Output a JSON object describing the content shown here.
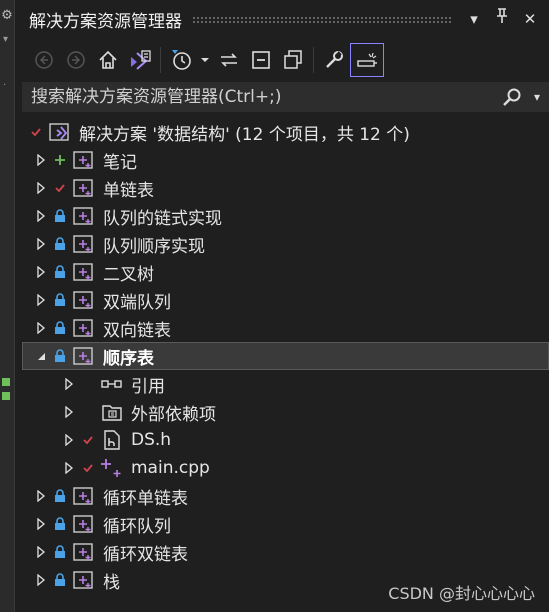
{
  "window": {
    "title": "解决方案资源管理器",
    "buttons": [
      "▾",
      "⊥",
      "✕"
    ]
  },
  "toolbar": {
    "items": [
      "back-icon",
      "forward-icon",
      "home-icon",
      "vs-solution-switch-icon",
      "history-icon",
      "dropdown-icon",
      "sync-icon",
      "collapse-all-icon",
      "show-all-files-icon",
      "properties-wrench-icon",
      "preview-selected-icon"
    ]
  },
  "search": {
    "placeholder": "搜索解决方案资源管理器(Ctrl+;)"
  },
  "solution": {
    "label": "解决方案 '数据结构' (12 个项目，共 12 个)"
  },
  "tree": [
    {
      "label": "笔记",
      "status": "add",
      "depth": 0,
      "icon": "project",
      "expander": "collapsed"
    },
    {
      "label": "单链表",
      "status": "check",
      "depth": 0,
      "icon": "project",
      "expander": "collapsed"
    },
    {
      "label": "队列的链式实现",
      "status": "lock",
      "depth": 0,
      "icon": "project",
      "expander": "collapsed"
    },
    {
      "label": "队列顺序实现",
      "status": "lock",
      "depth": 0,
      "icon": "project",
      "expander": "collapsed"
    },
    {
      "label": "二叉树",
      "status": "lock",
      "depth": 0,
      "icon": "project",
      "expander": "collapsed"
    },
    {
      "label": "双端队列",
      "status": "lock",
      "depth": 0,
      "icon": "project",
      "expander": "collapsed"
    },
    {
      "label": "双向链表",
      "status": "lock",
      "depth": 0,
      "icon": "project",
      "expander": "collapsed"
    },
    {
      "label": "顺序表",
      "status": "lock",
      "depth": 0,
      "icon": "project",
      "expander": "expanded",
      "selected": true,
      "bold": true
    },
    {
      "label": "引用",
      "status": "none",
      "depth": 1,
      "icon": "references",
      "expander": "collapsed"
    },
    {
      "label": "外部依赖项",
      "status": "none",
      "depth": 1,
      "icon": "external-deps",
      "expander": "collapsed"
    },
    {
      "label": "DS.h",
      "status": "check",
      "depth": 1,
      "icon": "header-file",
      "expander": "collapsed"
    },
    {
      "label": "main.cpp",
      "status": "check",
      "depth": 1,
      "icon": "cpp-file",
      "expander": "collapsed"
    },
    {
      "label": "循环单链表",
      "status": "lock",
      "depth": 0,
      "icon": "project",
      "expander": "collapsed"
    },
    {
      "label": "循环队列",
      "status": "lock",
      "depth": 0,
      "icon": "project",
      "expander": "collapsed"
    },
    {
      "label": "循环双链表",
      "status": "lock",
      "depth": 0,
      "icon": "project",
      "expander": "collapsed"
    },
    {
      "label": "栈",
      "status": "lock",
      "depth": 0,
      "icon": "project",
      "expander": "collapsed"
    }
  ],
  "watermark": "CSDN @封心心心心",
  "colors": {
    "accent": "#8a82ff",
    "check": "#d0454c",
    "add": "#6fbf5a",
    "lock": "#4aa3e8",
    "project": "#b880e0"
  }
}
